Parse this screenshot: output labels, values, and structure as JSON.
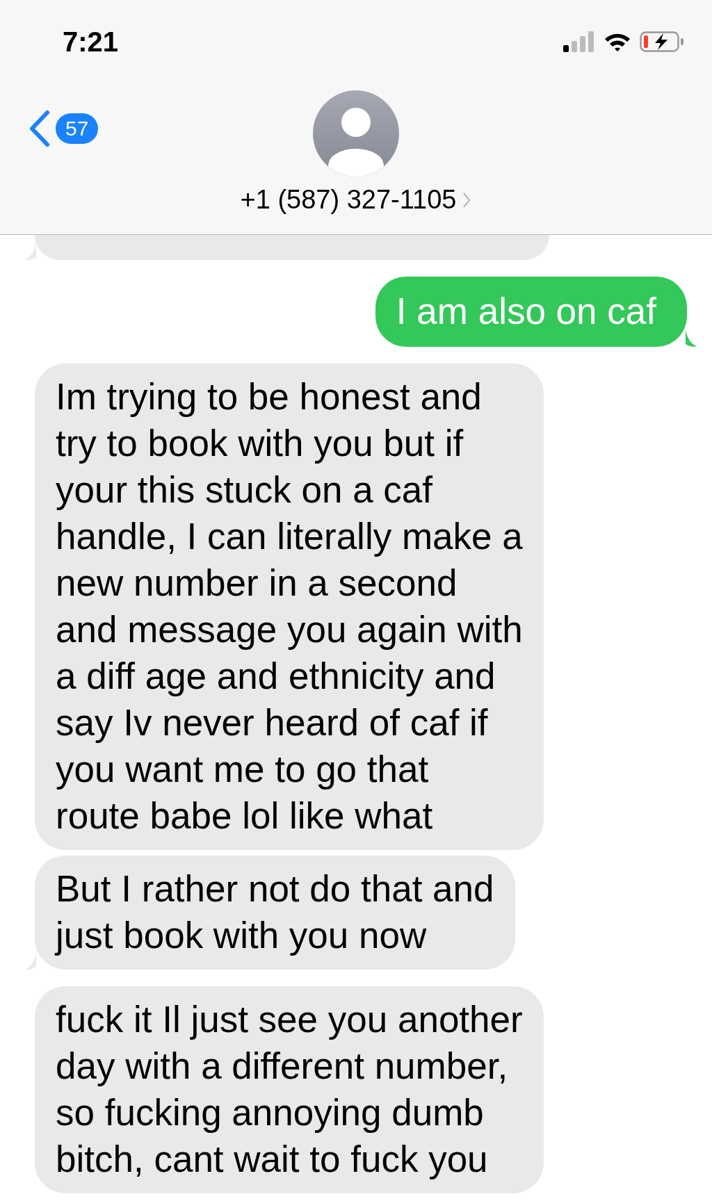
{
  "status_bar": {
    "time": "7:21"
  },
  "header": {
    "back_badge": "57",
    "contact": "+1 (587) 327-1105"
  },
  "messages": [
    {
      "kind": "received_partial",
      "tail": true
    },
    {
      "kind": "sent",
      "tail": true,
      "text": "I am also on caf"
    },
    {
      "kind": "received",
      "tail": false,
      "text": "Im trying to be honest and\ntry to book with you but if\nyour this stuck on a caf\nhandle, I can literally make a\nnew number in a second\nand message you again with\na diff age and ethnicity and\nsay Iv never heard of caf if\nyou want me to go that\nroute babe lol like what"
    },
    {
      "kind": "received",
      "tail": true,
      "text": "But I rather not do that and\njust book with you now"
    },
    {
      "kind": "received",
      "tail": false,
      "text": "fuck it Il just see you another\nday with a different number,\nso fucking annoying dumb\nbitch, cant wait to fuck you"
    }
  ]
}
